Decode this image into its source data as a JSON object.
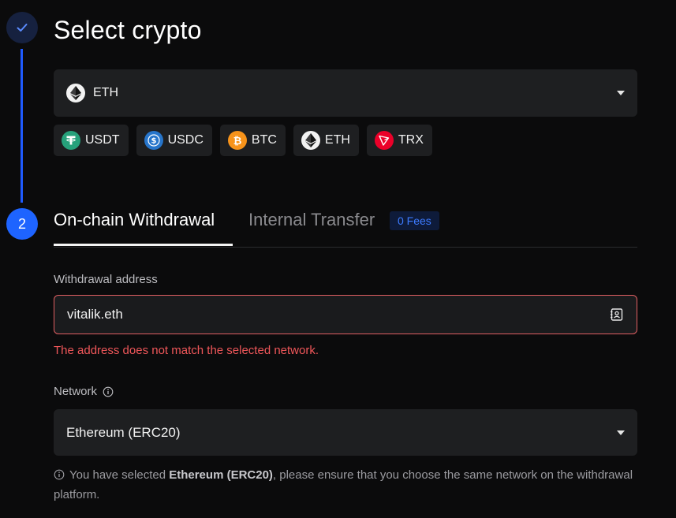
{
  "steps": {
    "step1_icon": "check-icon",
    "step2_number": "2",
    "accent_color": "#1e64ff"
  },
  "crypto_section": {
    "title": "Select crypto",
    "selected": {
      "label": "ETH",
      "icon": "eth-icon"
    },
    "chips": [
      {
        "label": "USDT",
        "icon": "usdt-icon",
        "color": "#26a17b"
      },
      {
        "label": "USDC",
        "icon": "usdc-icon",
        "color": "#2775ca"
      },
      {
        "label": "BTC",
        "icon": "btc-icon",
        "color": "#f7931a"
      },
      {
        "label": "ETH",
        "icon": "eth-icon",
        "color": "#3c3c3d"
      },
      {
        "label": "TRX",
        "icon": "trx-icon",
        "color": "#eb0029"
      }
    ]
  },
  "tabs": {
    "active": "On-chain Withdrawal",
    "inactive": "Internal Transfer",
    "badge": "0 Fees"
  },
  "address": {
    "label": "Withdrawal address",
    "value": "vitalik.eth",
    "error": "The address does not match the selected network.",
    "error_color": "#f0575a"
  },
  "network": {
    "label": "Network",
    "selected": "Ethereum (ERC20)",
    "note_prefix": "You have selected ",
    "note_bold": "Ethereum (ERC20)",
    "note_suffix": ", please ensure that you choose the same network on the withdrawal platform."
  }
}
